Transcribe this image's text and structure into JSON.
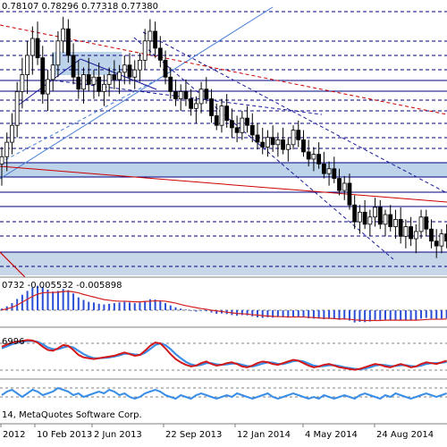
{
  "price_panel": {
    "ohlc_label": "0.78107 0.78296 0.77318 0.77380"
  },
  "macd_panel": {
    "values_label": "0732 -0.005532 -0.005898"
  },
  "stoch_panel": {
    "value_label": "6996"
  },
  "bottom_panel": {
    "copyright": "14, MetaQuotes Software Corp."
  },
  "colors": {
    "candle": "#000000",
    "grid": "#000080",
    "trend_red": "#cc0000",
    "zone_fill": "#bcd3ea",
    "channel": "#1a1a9a",
    "fan_blue": "#4a7fd6",
    "histogram": "#2a4fd6",
    "signal_red": "#d22020",
    "stoch_blue": "#3a8ee8",
    "stoch_red": "#d21818"
  },
  "chart_data": {
    "type": "candlestick",
    "symbol_values": {
      "open": 0.78107,
      "high": 0.78296,
      "low": 0.77318,
      "close": 0.7738
    },
    "x_tick_labels": [
      "2012",
      "10 Feb 2013",
      "2 Jun 2013",
      "22 Sep 2013",
      "12 Jan 2014",
      "4 May 2014",
      "24 Aug 2014"
    ],
    "candles": [
      [
        0.735,
        0.742,
        0.726,
        0.738
      ],
      [
        0.738,
        0.748,
        0.732,
        0.744
      ],
      [
        0.744,
        0.756,
        0.739,
        0.751
      ],
      [
        0.751,
        0.769,
        0.746,
        0.765
      ],
      [
        0.765,
        0.779,
        0.758,
        0.772
      ],
      [
        0.772,
        0.786,
        0.764,
        0.78
      ],
      [
        0.78,
        0.792,
        0.772,
        0.787
      ],
      [
        0.787,
        0.794,
        0.776,
        0.779
      ],
      [
        0.779,
        0.784,
        0.76,
        0.764
      ],
      [
        0.764,
        0.774,
        0.757,
        0.77
      ],
      [
        0.77,
        0.781,
        0.765,
        0.776
      ],
      [
        0.776,
        0.79,
        0.771,
        0.786
      ],
      [
        0.786,
        0.796,
        0.781,
        0.791
      ],
      [
        0.791,
        0.795,
        0.777,
        0.78
      ],
      [
        0.78,
        0.785,
        0.768,
        0.771
      ],
      [
        0.771,
        0.778,
        0.762,
        0.766
      ],
      [
        0.766,
        0.775,
        0.76,
        0.772
      ],
      [
        0.772,
        0.779,
        0.765,
        0.768
      ],
      [
        0.768,
        0.774,
        0.762,
        0.771
      ],
      [
        0.771,
        0.777,
        0.763,
        0.765
      ],
      [
        0.765,
        0.772,
        0.759,
        0.768
      ],
      [
        0.768,
        0.775,
        0.763,
        0.772
      ],
      [
        0.772,
        0.778,
        0.766,
        0.77
      ],
      [
        0.77,
        0.776,
        0.764,
        0.773
      ],
      [
        0.773,
        0.78,
        0.768,
        0.776
      ],
      [
        0.776,
        0.781,
        0.768,
        0.771
      ],
      [
        0.771,
        0.778,
        0.766,
        0.774
      ],
      [
        0.774,
        0.781,
        0.769,
        0.778
      ],
      [
        0.778,
        0.791,
        0.774,
        0.786
      ],
      [
        0.786,
        0.795,
        0.78,
        0.79
      ],
      [
        0.79,
        0.794,
        0.779,
        0.783
      ],
      [
        0.783,
        0.788,
        0.775,
        0.778
      ],
      [
        0.778,
        0.782,
        0.768,
        0.771
      ],
      [
        0.771,
        0.775,
        0.762,
        0.765
      ],
      [
        0.765,
        0.77,
        0.759,
        0.762
      ],
      [
        0.762,
        0.768,
        0.757,
        0.765
      ],
      [
        0.765,
        0.77,
        0.759,
        0.762
      ],
      [
        0.762,
        0.766,
        0.755,
        0.758
      ],
      [
        0.758,
        0.763,
        0.752,
        0.76
      ],
      [
        0.76,
        0.769,
        0.756,
        0.766
      ],
      [
        0.766,
        0.771,
        0.76,
        0.762
      ],
      [
        0.762,
        0.766,
        0.752,
        0.755
      ],
      [
        0.755,
        0.76,
        0.749,
        0.751
      ],
      [
        0.751,
        0.762,
        0.748,
        0.759
      ],
      [
        0.759,
        0.764,
        0.75,
        0.753
      ],
      [
        0.753,
        0.758,
        0.746,
        0.75
      ],
      [
        0.75,
        0.755,
        0.744,
        0.748
      ],
      [
        0.748,
        0.757,
        0.745,
        0.754
      ],
      [
        0.754,
        0.759,
        0.748,
        0.751
      ],
      [
        0.751,
        0.756,
        0.744,
        0.747
      ],
      [
        0.747,
        0.752,
        0.741,
        0.744
      ],
      [
        0.744,
        0.75,
        0.739,
        0.742
      ],
      [
        0.742,
        0.749,
        0.738,
        0.746
      ],
      [
        0.746,
        0.751,
        0.74,
        0.743
      ],
      [
        0.743,
        0.748,
        0.738,
        0.745
      ],
      [
        0.745,
        0.75,
        0.739,
        0.741
      ],
      [
        0.741,
        0.746,
        0.736,
        0.743
      ],
      [
        0.743,
        0.751,
        0.741,
        0.749
      ],
      [
        0.749,
        0.753,
        0.742,
        0.745
      ],
      [
        0.745,
        0.749,
        0.738,
        0.74
      ],
      [
        0.74,
        0.745,
        0.734,
        0.737
      ],
      [
        0.737,
        0.742,
        0.732,
        0.739
      ],
      [
        0.739,
        0.744,
        0.733,
        0.735
      ],
      [
        0.735,
        0.74,
        0.729,
        0.731
      ],
      [
        0.731,
        0.736,
        0.726,
        0.733
      ],
      [
        0.733,
        0.738,
        0.727,
        0.729
      ],
      [
        0.729,
        0.733,
        0.722,
        0.724
      ],
      [
        0.724,
        0.73,
        0.72,
        0.727
      ],
      [
        0.727,
        0.731,
        0.716,
        0.718
      ],
      [
        0.718,
        0.722,
        0.708,
        0.711
      ],
      [
        0.711,
        0.718,
        0.706,
        0.715
      ],
      [
        0.715,
        0.72,
        0.708,
        0.71
      ],
      [
        0.71,
        0.716,
        0.705,
        0.713
      ],
      [
        0.713,
        0.721,
        0.709,
        0.717
      ],
      [
        0.717,
        0.72,
        0.708,
        0.71
      ],
      [
        0.71,
        0.716,
        0.705,
        0.714
      ],
      [
        0.714,
        0.718,
        0.707,
        0.709
      ],
      [
        0.709,
        0.716,
        0.704,
        0.712
      ],
      [
        0.712,
        0.717,
        0.702,
        0.705
      ],
      [
        0.705,
        0.712,
        0.7,
        0.709
      ],
      [
        0.709,
        0.713,
        0.701,
        0.704
      ],
      [
        0.704,
        0.71,
        0.698,
        0.707
      ],
      [
        0.707,
        0.716,
        0.704,
        0.713
      ],
      [
        0.713,
        0.716,
        0.705,
        0.708
      ],
      [
        0.708,
        0.712,
        0.7,
        0.703
      ],
      [
        0.703,
        0.708,
        0.696,
        0.701
      ],
      [
        0.701,
        0.708,
        0.698,
        0.706
      ],
      [
        0.706,
        0.71,
        0.7,
        0.703
      ]
    ],
    "macd_histogram": [
      0.5,
      1.2,
      2.2,
      3.5,
      4.8,
      6.0,
      7.0,
      7.6,
      7.2,
      6.4,
      5.8,
      6.0,
      6.6,
      6.2,
      5.2,
      4.0,
      3.2,
      2.6,
      2.4,
      2.0,
      1.8,
      2.0,
      2.2,
      2.4,
      2.6,
      2.4,
      2.2,
      2.4,
      2.9,
      3.4,
      3.3,
      2.9,
      2.2,
      1.5,
      0.9,
      0.5,
      0.2,
      -0.2,
      -0.4,
      -0.2,
      -0.3,
      -0.7,
      -1.1,
      -1.0,
      -1.2,
      -1.5,
      -1.7,
      -1.5,
      -1.6,
      -1.9,
      -2.2,
      -2.4,
      -2.2,
      -2.3,
      -2.1,
      -2.2,
      -2.3,
      -2.0,
      -2.0,
      -2.2,
      -2.5,
      -2.6,
      -2.6,
      -2.8,
      -2.7,
      -2.8,
      -3.0,
      -2.9,
      -3.2,
      -3.8,
      -3.6,
      -3.7,
      -3.5,
      -3.0,
      -3.0,
      -2.9,
      -3.0,
      -2.9,
      -3.1,
      -3.0,
      -3.1,
      -3.2,
      -2.6,
      -2.4,
      -2.6,
      -2.9,
      -2.6,
      -2.5
    ],
    "macd_signal": [
      0.1,
      0.4,
      0.9,
      1.6,
      2.5,
      3.4,
      4.3,
      5.0,
      5.4,
      5.5,
      5.5,
      5.6,
      5.8,
      5.9,
      5.7,
      5.4,
      4.9,
      4.5,
      4.1,
      3.7,
      3.3,
      3.1,
      2.9,
      2.8,
      2.8,
      2.7,
      2.6,
      2.6,
      2.7,
      2.8,
      2.9,
      2.9,
      2.8,
      2.5,
      2.2,
      1.8,
      1.4,
      1.1,
      0.8,
      0.5,
      0.3,
      0.0,
      -0.2,
      -0.4,
      -0.6,
      -0.8,
      -1.0,
      -1.1,
      -1.2,
      -1.4,
      -1.5,
      -1.7,
      -1.8,
      -1.9,
      -2.0,
      -2.0,
      -2.1,
      -2.1,
      -2.1,
      -2.1,
      -2.2,
      -2.3,
      -2.4,
      -2.5,
      -2.5,
      -2.6,
      -2.7,
      -2.7,
      -2.8,
      -3.0,
      -3.1,
      -3.2,
      -3.2,
      -3.2,
      -3.2,
      -3.1,
      -3.1,
      -3.1,
      -3.1,
      -3.1,
      -3.1,
      -3.1,
      -3.0,
      -2.9,
      -2.8,
      -2.8,
      -2.8,
      -2.7
    ],
    "stoch_main": [
      70,
      75,
      80,
      82,
      84,
      86,
      85,
      80,
      70,
      62,
      60,
      66,
      74,
      72,
      62,
      50,
      44,
      42,
      40,
      42,
      44,
      46,
      48,
      52,
      56,
      52,
      48,
      50,
      60,
      72,
      80,
      78,
      66,
      52,
      40,
      32,
      26,
      22,
      24,
      30,
      34,
      28,
      24,
      26,
      30,
      32,
      28,
      22,
      20,
      24,
      30,
      34,
      32,
      28,
      26,
      30,
      34,
      38,
      36,
      30,
      24,
      20,
      22,
      26,
      28,
      24,
      20,
      18,
      16,
      14,
      16,
      20,
      24,
      28,
      26,
      22,
      20,
      24,
      28,
      24,
      20,
      22,
      28,
      32,
      30,
      28,
      32,
      36
    ],
    "stoch_signal": [
      66,
      71,
      76,
      80,
      82,
      84,
      84,
      82,
      76,
      68,
      64,
      64,
      68,
      71,
      68,
      60,
      52,
      46,
      42,
      42,
      43,
      44,
      46,
      49,
      53,
      53,
      51,
      50,
      55,
      64,
      74,
      78,
      74,
      64,
      52,
      42,
      33,
      27,
      24,
      26,
      30,
      30,
      27,
      26,
      27,
      29,
      29,
      26,
      23,
      22,
      25,
      29,
      32,
      31,
      28,
      28,
      31,
      35,
      36,
      34,
      29,
      24,
      22,
      23,
      25,
      25,
      23,
      20,
      18,
      16,
      15,
      17,
      20,
      24,
      26,
      25,
      23,
      23,
      25,
      25,
      23,
      22,
      24,
      28,
      30,
      30,
      31,
      33
    ],
    "bottom_line": [
      0.5,
      0.7,
      0.8,
      0.6,
      0.4,
      0.6,
      0.8,
      0.7,
      0.5,
      0.6,
      0.7,
      0.9,
      0.8,
      0.7,
      0.5,
      0.6,
      0.4,
      0.5,
      0.6,
      0.7,
      0.6,
      0.8,
      0.7,
      0.5,
      0.6,
      0.4,
      0.3,
      0.4,
      0.6,
      0.7,
      0.8,
      0.7,
      0.5,
      0.4,
      0.3,
      0.5,
      0.4,
      0.3,
      0.5,
      0.6,
      0.5,
      0.4,
      0.3,
      0.4,
      0.5,
      0.4,
      0.6,
      0.5,
      0.4,
      0.3,
      0.4,
      0.5,
      0.6,
      0.4,
      0.3,
      0.4,
      0.5,
      0.6,
      0.5,
      0.4,
      0.3,
      0.4,
      0.3,
      0.5,
      0.4,
      0.3,
      0.4,
      0.5,
      0.4,
      0.3,
      0.5,
      0.6,
      0.5,
      0.4,
      0.3,
      0.5,
      0.4,
      0.6,
      0.5,
      0.4,
      0.3,
      0.4,
      0.5,
      0.6,
      0.5,
      0.4,
      0.5,
      0.6
    ]
  }
}
